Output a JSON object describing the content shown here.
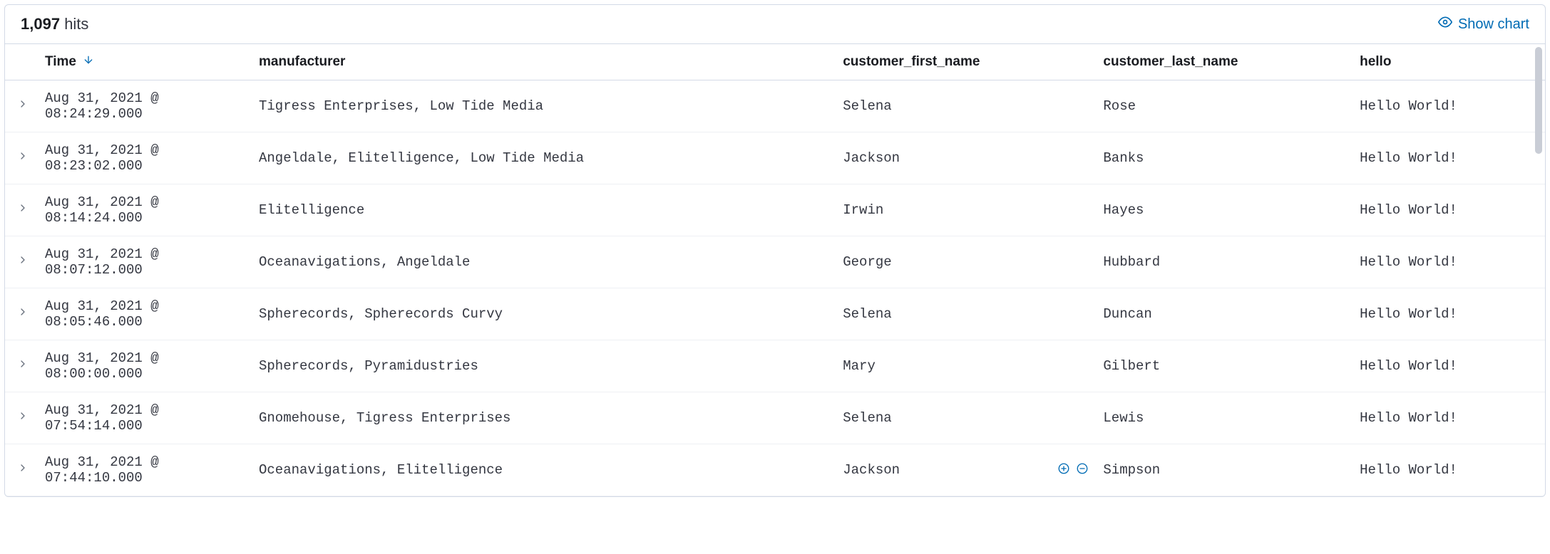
{
  "header": {
    "hits_count": "1,097",
    "hits_label": "hits",
    "show_chart_label": "Show chart"
  },
  "columns": {
    "time": "Time",
    "manufacturer": "manufacturer",
    "customer_first_name": "customer_first_name",
    "customer_last_name": "customer_last_name",
    "hello": "hello"
  },
  "rows": [
    {
      "time": "Aug 31, 2021 @ 08:24:29.000",
      "manufacturer": "Tigress Enterprises, Low Tide Media",
      "customer_first_name": "Selena",
      "customer_last_name": "Rose",
      "hello": "Hello World!",
      "hover": false
    },
    {
      "time": "Aug 31, 2021 @ 08:23:02.000",
      "manufacturer": "Angeldale, Elitelligence, Low Tide Media",
      "customer_first_name": "Jackson",
      "customer_last_name": "Banks",
      "hello": "Hello World!",
      "hover": false
    },
    {
      "time": "Aug 31, 2021 @ 08:14:24.000",
      "manufacturer": "Elitelligence",
      "customer_first_name": "Irwin",
      "customer_last_name": "Hayes",
      "hello": "Hello World!",
      "hover": false
    },
    {
      "time": "Aug 31, 2021 @ 08:07:12.000",
      "manufacturer": "Oceanavigations, Angeldale",
      "customer_first_name": "George",
      "customer_last_name": "Hubbard",
      "hello": "Hello World!",
      "hover": false
    },
    {
      "time": "Aug 31, 2021 @ 08:05:46.000",
      "manufacturer": "Spherecords, Spherecords Curvy",
      "customer_first_name": "Selena",
      "customer_last_name": "Duncan",
      "hello": "Hello World!",
      "hover": false
    },
    {
      "time": "Aug 31, 2021 @ 08:00:00.000",
      "manufacturer": "Spherecords, Pyramidustries",
      "customer_first_name": "Mary",
      "customer_last_name": "Gilbert",
      "hello": "Hello World!",
      "hover": false
    },
    {
      "time": "Aug 31, 2021 @ 07:54:14.000",
      "manufacturer": "Gnomehouse, Tigress Enterprises",
      "customer_first_name": "Selena",
      "customer_last_name": "Lewis",
      "hello": "Hello World!",
      "hover": false
    },
    {
      "time": "Aug 31, 2021 @ 07:44:10.000",
      "manufacturer": "Oceanavigations, Elitelligence",
      "customer_first_name": "Jackson",
      "customer_last_name": "Simpson",
      "hello": "Hello World!",
      "hover": true
    }
  ]
}
